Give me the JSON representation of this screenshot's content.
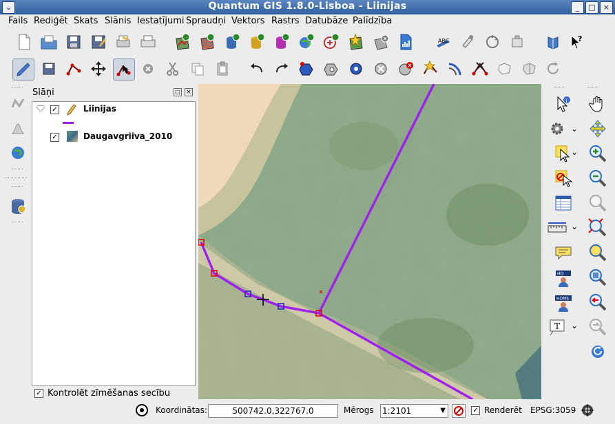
{
  "window": {
    "title": "Quantum GIS 1.8.0-Lisboa - Liinijas",
    "menu_icon": "chevron-down-icon"
  },
  "menubar": {
    "items": [
      "Fails",
      "Rediģēt",
      "Skats",
      "Slānis",
      "Iestatījumi",
      "Spraudņi",
      "Vektors",
      "Rastrs",
      "Datubāze",
      "Palīdzība"
    ]
  },
  "layers_panel": {
    "title": "Slāņi",
    "layers": [
      {
        "name": "Liinijas",
        "checked": true,
        "symbol_color": "#a020f0"
      },
      {
        "name": "Daugavgriiva_2010",
        "checked": true
      }
    ],
    "render_order_label": "Kontrolēt zīmēšanas secību",
    "render_order_checked": true
  },
  "statusbar": {
    "coord_label": "Koordinātas:",
    "coord_value": "500742.0,322767.0",
    "scale_label": "Mērogs",
    "scale_value": "1:2101",
    "render_label": "Renderēt",
    "render_checked": true,
    "crs_label": "EPSG:3059"
  },
  "colors": {
    "titlebar": "#3a6aa8",
    "line": "#a020f0",
    "vertex_red": "#e00000",
    "vertex_blue": "#2020c0"
  }
}
